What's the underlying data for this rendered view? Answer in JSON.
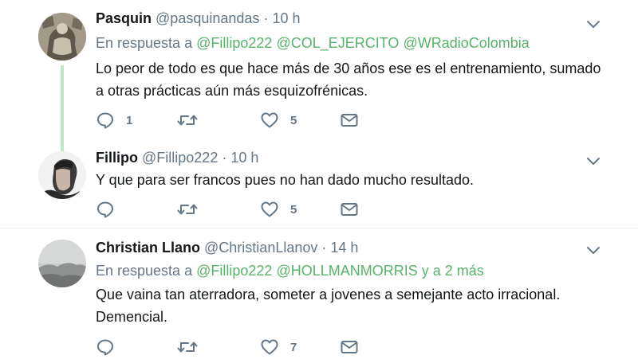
{
  "colors": {
    "mention": "#58b36a",
    "muted": "#657786",
    "text": "#14171a",
    "thread_line": "#c3e6c9"
  },
  "tweets": [
    {
      "name": "Pasquin",
      "handle": "@pasquinandas",
      "dot": "·",
      "time": "10 h",
      "reply_prefix": "En respuesta a",
      "mentions": [
        "@Fillipo222",
        "@COL_EJERCITO",
        "@WRadioColombia"
      ],
      "text": "Lo peor de todo es que hace más de 30 años ese es el entrenamiento, sumado a otras prácticas aún más esquizofrénicas.",
      "replies": "1",
      "likes": "5"
    },
    {
      "name": "Fillipo",
      "handle": "@Fillipo222",
      "dot": "·",
      "time": "10 h",
      "text": "Y que para ser francos pues no han dado mucho resultado.",
      "replies": "",
      "likes": "5"
    },
    {
      "name": "Christian Llano",
      "handle": "@ChristianLlanov",
      "dot": "·",
      "time": "14 h",
      "reply_prefix": "En respuesta a",
      "mentions": [
        "@Fillipo222",
        "@HOLLMANMORRIS"
      ],
      "reply_suffix": "y a 2 más",
      "text": "Que vaina tan aterradora, someter a jovenes a semejante acto irracional. Demencial.",
      "replies": "",
      "likes": "7"
    }
  ]
}
